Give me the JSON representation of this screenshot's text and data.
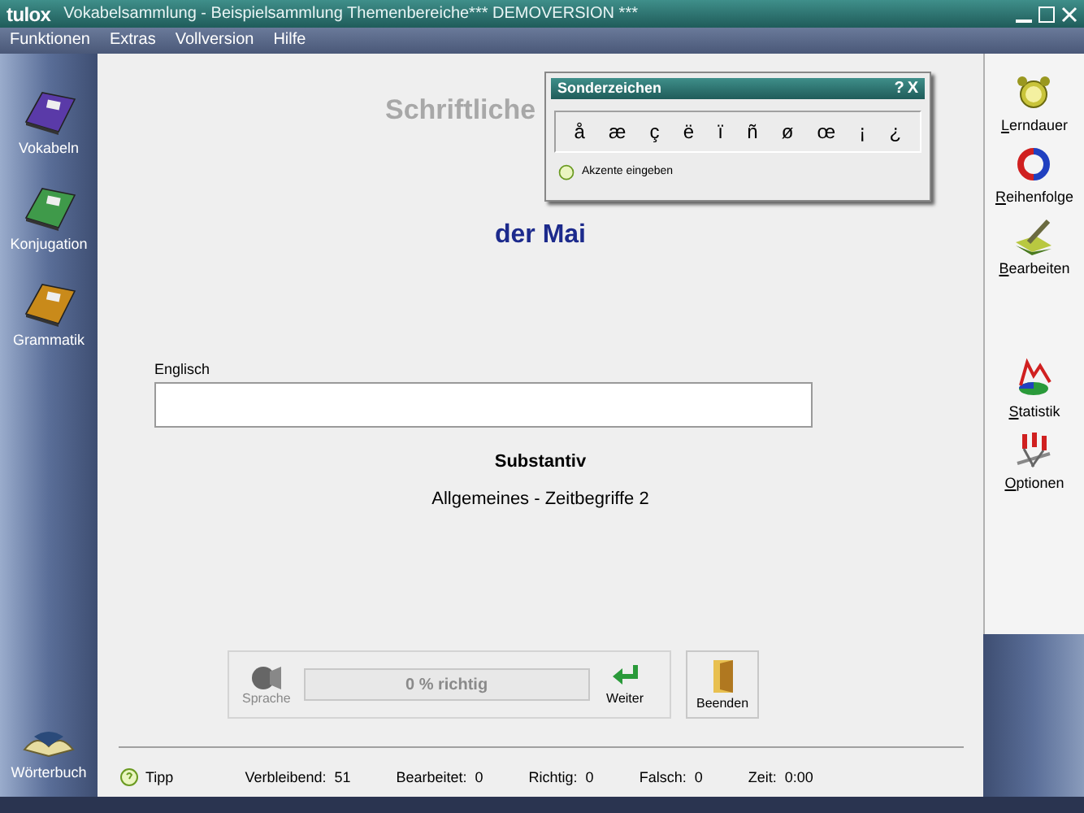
{
  "window": {
    "logo": "tulox",
    "title": "Vokabelsammlung - Beispielsammlung Themenbereiche*** DEMOVERSION ***"
  },
  "menu": [
    "Funktionen",
    "Extras",
    "Vollversion",
    "Hilfe"
  ],
  "left_sidebar": [
    {
      "label": "Vokabeln",
      "color": "#5a3aa8"
    },
    {
      "label": "Konjugation",
      "color": "#3f9a4a"
    },
    {
      "label": "Grammatik",
      "color": "#c98a1a"
    }
  ],
  "dictionary": {
    "label": "Wörterbuch"
  },
  "heading": "Schriftliche",
  "word": "der Mai",
  "answer": {
    "label": "Englisch"
  },
  "word_type": "Substantiv",
  "category": "Allgemeines - Zeitbegriffe 2",
  "controls": {
    "speech": "Sprache",
    "progress": {
      "reading": "0 % richtig",
      "level": 0
    },
    "next": "Weiter",
    "quit": "Beenden"
  },
  "status": {
    "tip": "Tipp",
    "items": [
      "Verbleibend:  51",
      "Bearbeitet:  0",
      "Richtig:  0",
      "Falsch:  0",
      "Zeit:  0:00"
    ]
  },
  "right_sidebar": [
    {
      "kind": "clock",
      "label": "Lerndauer"
    },
    {
      "kind": "order",
      "label": "Reihenfolge"
    },
    {
      "kind": "edit",
      "label": "Bearbeiten"
    },
    {
      "kind": "gap"
    },
    {
      "kind": "stats",
      "label": "Statistik"
    },
    {
      "kind": "options",
      "label": "Optionen"
    }
  ],
  "dialog": {
    "title": "Sonderzeichen",
    "help": "?",
    "close": "X",
    "chars": [
      "å",
      "æ",
      "ç",
      "ë",
      "ï",
      "ñ",
      "ø",
      "œ",
      "¡",
      "¿"
    ],
    "hint": "Akzente eingeben"
  }
}
